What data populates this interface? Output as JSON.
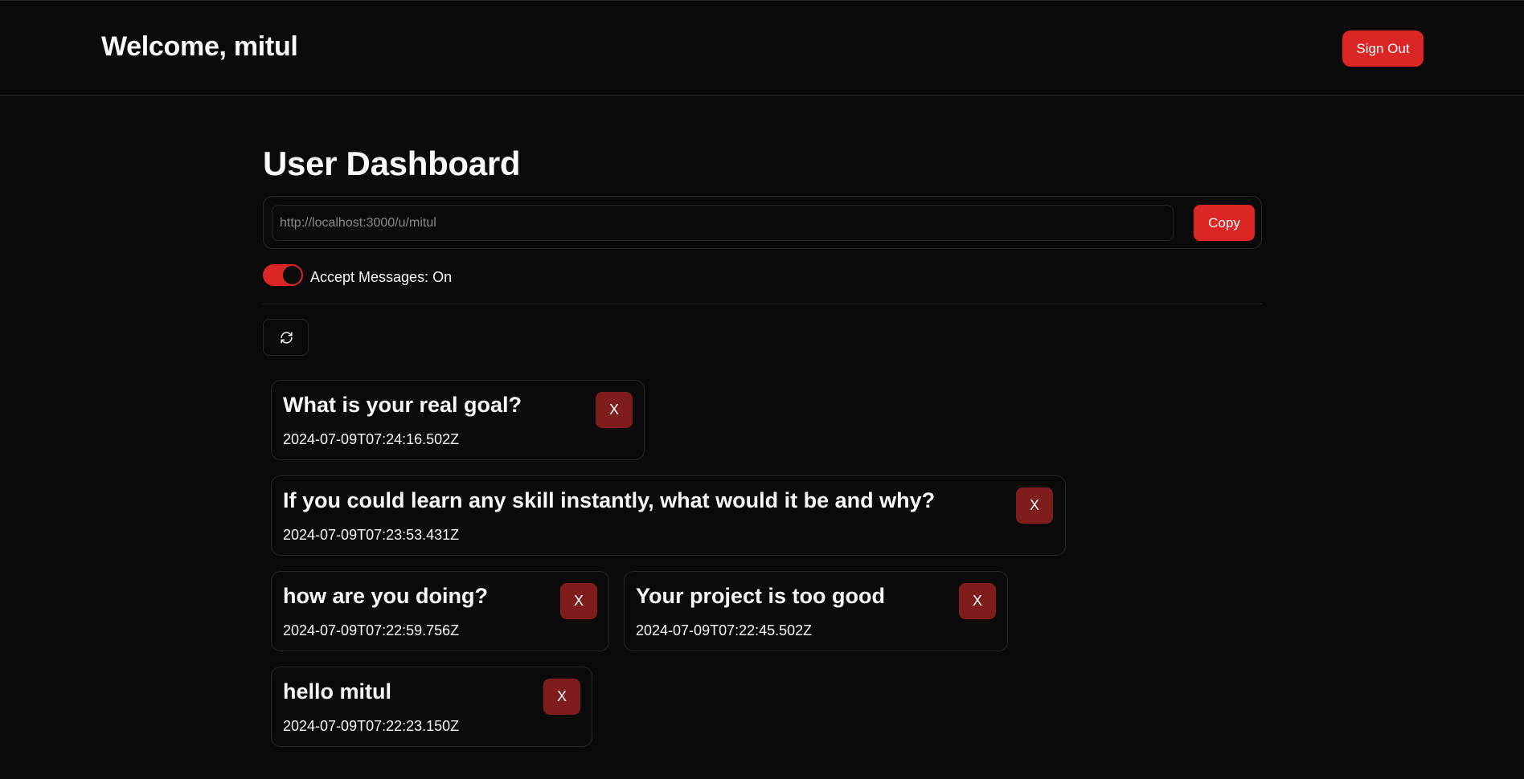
{
  "header": {
    "welcome": "Welcome, mitul",
    "sign_out_label": "Sign Out"
  },
  "dashboard": {
    "title": "User Dashboard",
    "profile_link": "http://localhost:3000/u/mitul",
    "copy_label": "Copy",
    "accept_messages_label": "Accept Messages: On",
    "accept_messages_on": true,
    "refresh_icon": "refresh-icon"
  },
  "messages": [
    {
      "content": "What is your real goal?",
      "created_at": "2024-07-09T07:24:16.502Z",
      "delete_label": "X"
    },
    {
      "content": "If you could learn any skill instantly, what would it be and why?",
      "created_at": "2024-07-09T07:23:53.431Z",
      "delete_label": "X"
    },
    {
      "content": "how are you doing?",
      "created_at": "2024-07-09T07:22:59.756Z",
      "delete_label": "X"
    },
    {
      "content": "Your project is too good",
      "created_at": "2024-07-09T07:22:45.502Z",
      "delete_label": "X"
    },
    {
      "content": "hello mitul",
      "created_at": "2024-07-09T07:22:23.150Z",
      "delete_label": "X"
    }
  ],
  "colors": {
    "background": "#0a0a0a",
    "accent": "#dc2626",
    "delete_button": "#7f1d1d",
    "border": "#262626"
  }
}
